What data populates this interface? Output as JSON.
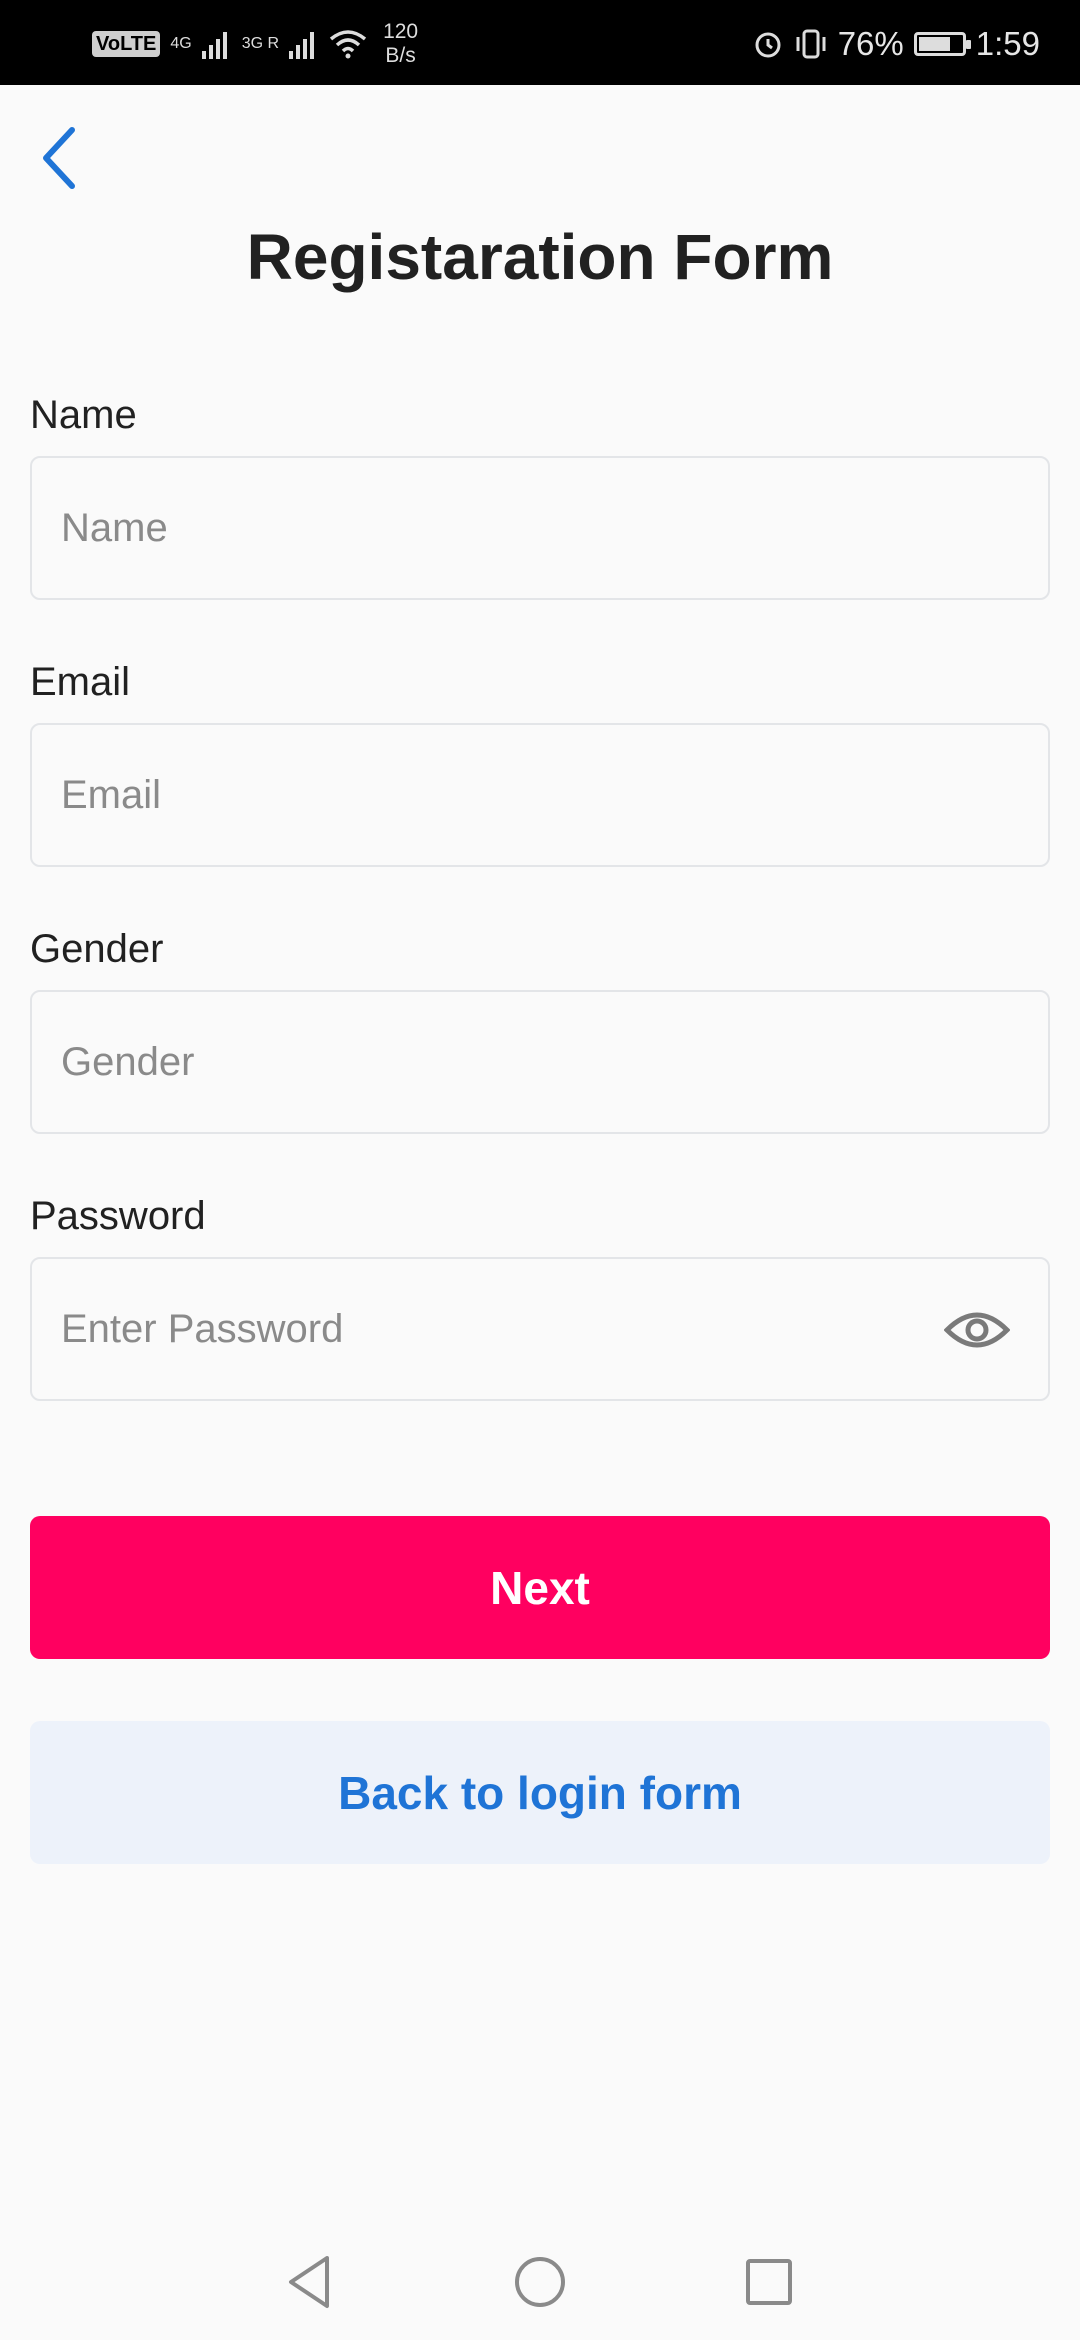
{
  "status_bar": {
    "volte": "VoLTE",
    "network_1": "4G",
    "network_2": "3G R",
    "speed_value": "120",
    "speed_unit": "B/s",
    "battery_percent": "76%",
    "battery_level": 0.76,
    "time": "1:59"
  },
  "header": {
    "back_icon": "chevron-left-icon",
    "title": "Registaration Form"
  },
  "form": {
    "fields": [
      {
        "label": "Name",
        "placeholder": "Name",
        "value": ""
      },
      {
        "label": "Email",
        "placeholder": "Email",
        "value": ""
      },
      {
        "label": "Gender",
        "placeholder": "Gender",
        "value": ""
      },
      {
        "label": "Password",
        "placeholder": "Enter Password",
        "value": "",
        "toggle_icon": "eye-icon"
      }
    ]
  },
  "actions": {
    "next_label": "Next",
    "back_to_login_label": "Back to login form"
  },
  "colors": {
    "accent": "#ff0060",
    "link": "#1f74d6",
    "secondary_bg": "#edf2fa"
  },
  "nav_bar": {
    "back_icon": "triangle-back-icon",
    "home_icon": "circle-home-icon",
    "recents_icon": "square-recents-icon"
  }
}
